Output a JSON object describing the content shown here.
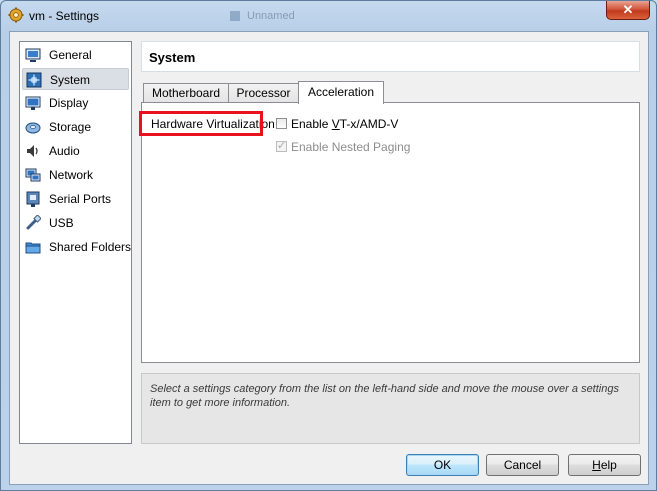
{
  "window": {
    "title": "vm - Settings",
    "close_label": "✕",
    "background_tab": "Unnamed"
  },
  "sidebar": {
    "items": [
      {
        "label": "General",
        "icon": "general-icon"
      },
      {
        "label": "System",
        "icon": "system-icon",
        "selected": true
      },
      {
        "label": "Display",
        "icon": "display-icon"
      },
      {
        "label": "Storage",
        "icon": "storage-icon"
      },
      {
        "label": "Audio",
        "icon": "audio-icon"
      },
      {
        "label": "Network",
        "icon": "network-icon"
      },
      {
        "label": "Serial Ports",
        "icon": "serial-ports-icon"
      },
      {
        "label": "USB",
        "icon": "usb-icon"
      },
      {
        "label": "Shared Folders",
        "icon": "shared-folders-icon"
      }
    ]
  },
  "header": {
    "title": "System"
  },
  "tabs": [
    {
      "label": "Motherboard"
    },
    {
      "label": "Processor"
    },
    {
      "label": "Acceleration",
      "active": true
    }
  ],
  "acceleration": {
    "hw_virt_label": "Hardware Virtualization:",
    "vtx_pre": "Enable ",
    "vtx_u": "V",
    "vtx_post": "T-x/AMD-V",
    "vtx_checked": false,
    "nested_label": "Enable Nested Paging",
    "nested_checked": true,
    "nested_enabled": false
  },
  "info": {
    "text": "Select a settings category from the list on the left-hand side and move the mouse over a settings item to get more information."
  },
  "buttons": {
    "ok": "OK",
    "cancel": "Cancel",
    "help_u": "H",
    "help_rest": "elp"
  },
  "colors": {
    "highlight": "#e8111d",
    "selected_bg": "#dadfe6"
  }
}
